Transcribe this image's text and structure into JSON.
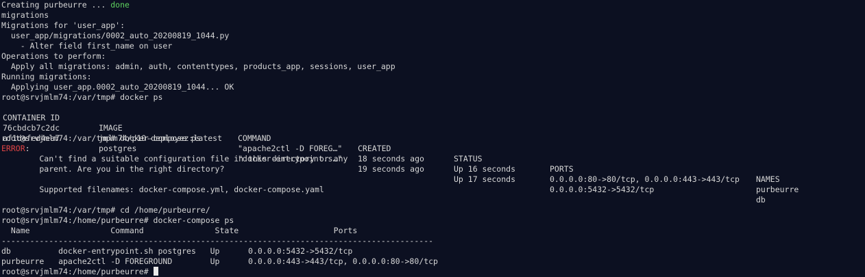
{
  "terminal": {
    "line1_prefix": "Creating purbeurre ... ",
    "line1_status": "done",
    "lines_a": [
      "migrations",
      "Migrations for 'user_app':",
      "  user_app/migrations/0002_auto_20200819_1044.py",
      "    - Alter field first_name on user",
      "Operations to perform:",
      "  Apply all migrations: admin, auth, contenttypes, products_app, sessions, user_app",
      "Running migrations:",
      "  Applying user_app.0002_auto_20200819_1044... OK",
      "root@srvjmlm74:/var/tmp# docker ps"
    ],
    "docker_ps": {
      "headers": {
        "id": "CONTAINER ID",
        "image": "IMAGE",
        "command": "COMMAND",
        "created": "CREATED",
        "status": "STATUS",
        "ports": "PORTS",
        "names": "NAMES"
      },
      "rows": [
        {
          "id": "76cbdcb7c2dc",
          "image": "jmlm74/p10-deployez:latest",
          "command": "\"apache2ctl -D FOREG…\"",
          "created": "18 seconds ago",
          "status": "Up 16 seconds",
          "ports": "0.0.0.0:80->80/tcp, 0.0.0.0:443->443/tcp",
          "names": "purbeurre"
        },
        {
          "id": "af1dafed4ea7",
          "image": "postgres",
          "command": "\"docker-entrypoint.s…\"",
          "created": "19 seconds ago",
          "status": "Up 17 seconds",
          "ports": "0.0.0.0:5432->5432/tcp",
          "names": "db"
        }
      ]
    },
    "prompt_compose1": "root@srvjmlm74:/var/tmp# docker-compose ps",
    "error_label": "ERROR",
    "error_colon": ":",
    "error_lines": [
      "        Can't find a suitable configuration file in this directory or any",
      "        parent. Are you in the right directory?",
      "",
      "        Supported filenames: docker-compose.yml, docker-compose.yaml",
      "",
      "root@srvjmlm74:/var/tmp# cd /home/purbeurre/",
      "root@srvjmlm74:/home/purbeurre# docker-compose ps"
    ],
    "compose_table": [
      "  Name                 Command               State                    Ports",
      "-------------------------------------------------------------------------------------------",
      "db          docker-entrypoint.sh postgres   Up      0.0.0.0:5432->5432/tcp",
      "purbeurre   apache2ctl -D FOREGROUND        Up      0.0.0.0:443->443/tcp, 0.0.0.0:80->80/tcp"
    ],
    "final_prompt": "root@srvjmlm74:/home/purbeurre# "
  },
  "colors": {
    "background": "#0c1021",
    "text": "#d6d6d6",
    "done": "#5fd35f",
    "error": "#e04545"
  }
}
